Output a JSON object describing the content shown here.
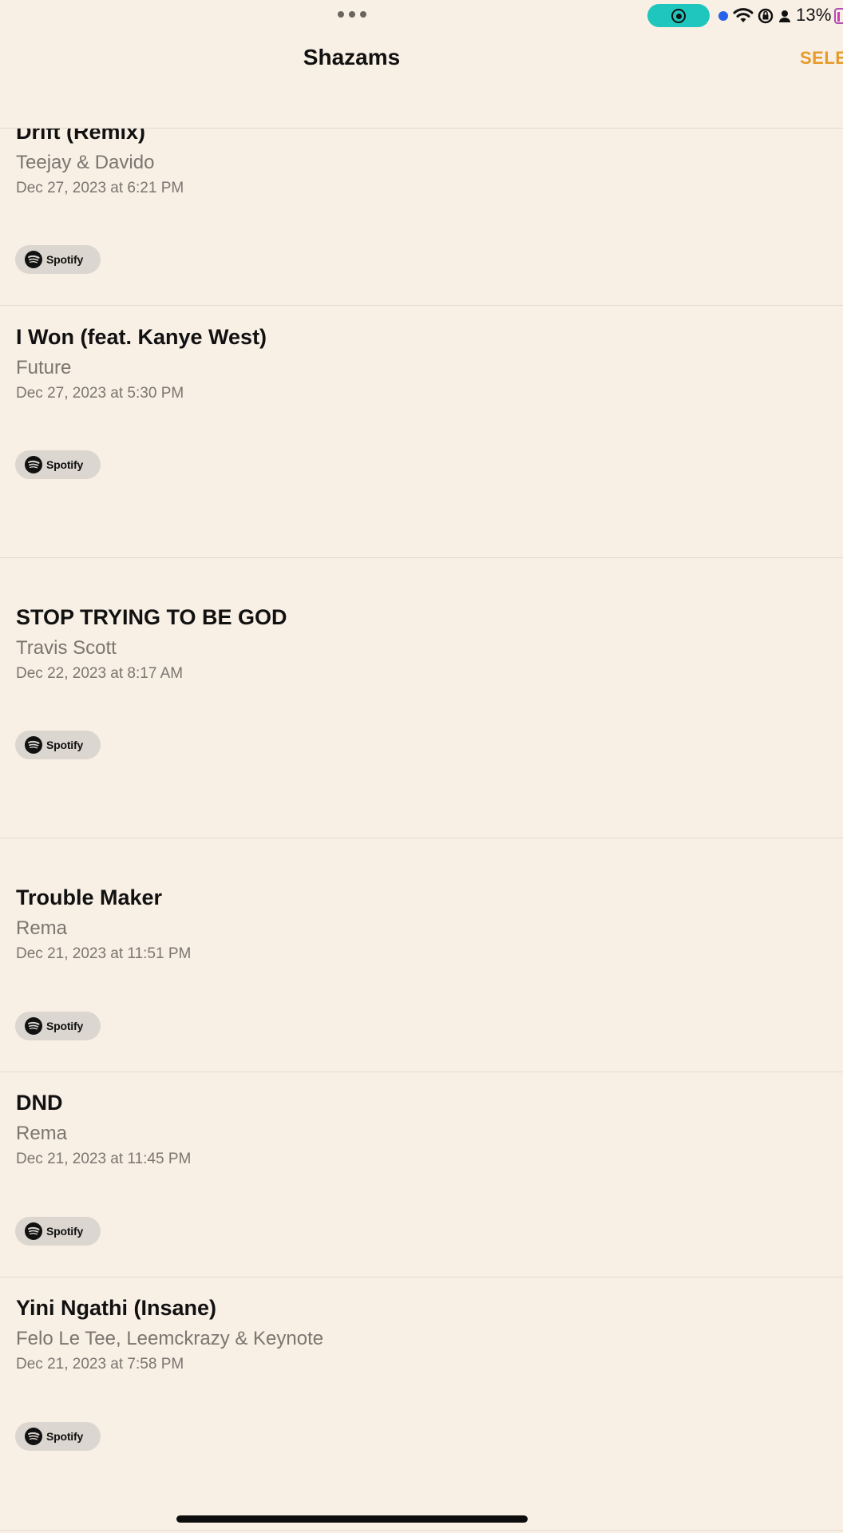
{
  "status_bar": {
    "battery_text": "13%",
    "icons": [
      "multitask-dots-icon",
      "screen-recording-icon",
      "wifi-icon",
      "orientation-lock-icon",
      "person-icon",
      "battery-icon"
    ],
    "recording_color": "#1fc6bd"
  },
  "header": {
    "title": "Shazams",
    "select_label": "SELE",
    "accent_color": "#e69a2a"
  },
  "shazams": [
    {
      "title": "Drift (Remix)",
      "artist": "Teejay & Davido",
      "date": "Dec 27, 2023 at 6:21 PM",
      "service": "Spotify"
    },
    {
      "title": "I Won (feat. Kanye West)",
      "artist": "Future",
      "date": "Dec 27, 2023 at 5:30 PM",
      "service": "Spotify"
    },
    {
      "title": "STOP TRYING TO BE GOD",
      "artist": "Travis Scott",
      "date": "Dec 22, 2023 at 8:17 AM",
      "service": "Spotify"
    },
    {
      "title": "Trouble Maker",
      "artist": "Rema",
      "date": "Dec 21, 2023 at 11:51 PM",
      "service": "Spotify"
    },
    {
      "title": "DND",
      "artist": "Rema",
      "date": "Dec 21, 2023 at 11:45 PM",
      "service": "Spotify"
    },
    {
      "title": "Yini Ngathi (Insane)",
      "artist": "Felo Le Tee, Leemckrazy & Keynote",
      "date": "Dec 21, 2023 at 7:58 PM",
      "service": "Spotify"
    }
  ]
}
